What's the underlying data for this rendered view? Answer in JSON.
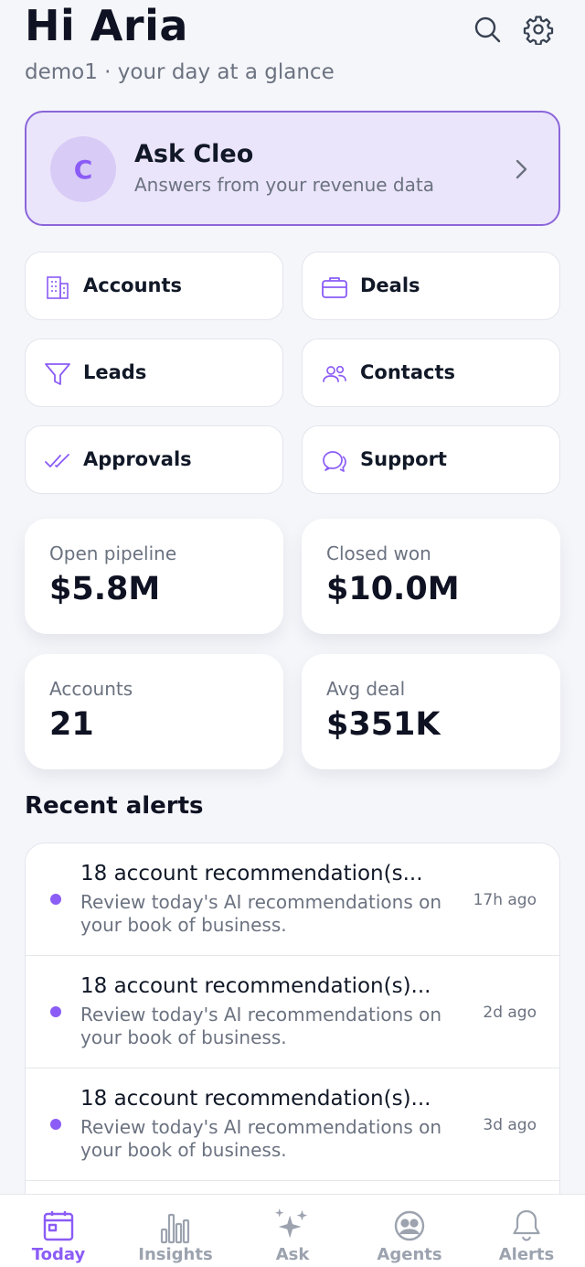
{
  "header": {
    "greeting": "Hi Aria",
    "subtitle": "demo1 · your day at a glance"
  },
  "ask_cleo": {
    "avatar_letter": "C",
    "title": "Ask Cleo",
    "subtitle": "Answers from your revenue data"
  },
  "nav": {
    "accounts": "Accounts",
    "deals": "Deals",
    "leads": "Leads",
    "contacts": "Contacts",
    "approvals": "Approvals",
    "support": "Support"
  },
  "stats": {
    "open_pipeline": {
      "label": "Open pipeline",
      "value": "$5.8M"
    },
    "closed_won": {
      "label": "Closed won",
      "value": "$10.0M"
    },
    "accounts": {
      "label": "Accounts",
      "value": "21"
    },
    "avg_deal": {
      "label": "Avg deal",
      "value": "$351K"
    }
  },
  "alerts": {
    "title": "Recent alerts",
    "items": [
      {
        "title": "18 account recommendation(s...",
        "body": "Review today's AI recommendations on your book of business.",
        "time": "17h ago"
      },
      {
        "title": "18 account recommendation(s)...",
        "body": "Review today's AI recommendations on your book of business.",
        "time": "2d ago"
      },
      {
        "title": "18 account recommendation(s)...",
        "body": "Review today's AI recommendations on your book of business.",
        "time": "3d ago"
      }
    ]
  },
  "tabs": {
    "today": "Today",
    "insights": "Insights",
    "ask": "Ask",
    "agents": "Agents",
    "alerts": "Alerts"
  },
  "colors": {
    "accent": "#8b5cf6",
    "cleo_bg": "#ebe5fb",
    "cleo_border": "#8b65d9",
    "background": "#f5f6fa"
  }
}
